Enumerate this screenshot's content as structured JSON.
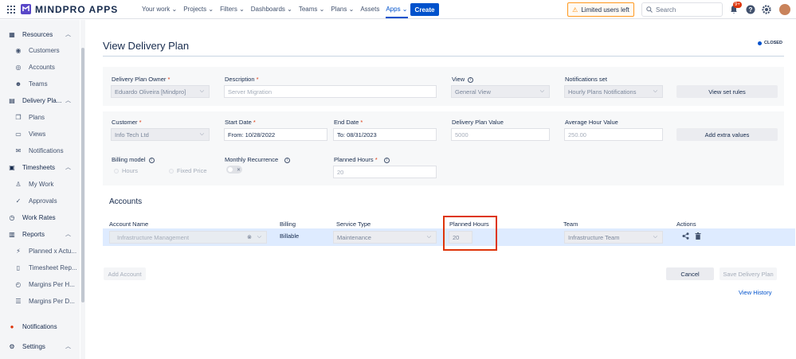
{
  "topbar": {
    "logo": "MINDPRO APPS",
    "nav": [
      "Your work",
      "Projects",
      "Filters",
      "Dashboards",
      "Teams",
      "Plans",
      "Assets",
      "Apps"
    ],
    "nav_dropdowns": [
      true,
      true,
      true,
      true,
      true,
      true,
      false,
      true
    ],
    "active_nav": "Apps",
    "create_label": "Create",
    "limited_label": "Limited users left",
    "search_placeholder": "Search",
    "notification_badge": "9+"
  },
  "sidebar": {
    "items": [
      {
        "label": "Resources",
        "type": "section",
        "icon": "grid-icon"
      },
      {
        "label": "Customers",
        "type": "item",
        "icon": "customer-icon"
      },
      {
        "label": "Accounts",
        "type": "item",
        "icon": "accounts-icon"
      },
      {
        "label": "Teams",
        "type": "item",
        "icon": "teams-icon"
      },
      {
        "label": "Delivery Pla...",
        "type": "section",
        "icon": "delivery-icon"
      },
      {
        "label": "Plans",
        "type": "item",
        "icon": "plans-icon"
      },
      {
        "label": "Views",
        "type": "item",
        "icon": "views-icon"
      },
      {
        "label": "Notifications",
        "type": "item",
        "icon": "bell-icon"
      },
      {
        "label": "Timesheets",
        "type": "section",
        "icon": "calendar-icon"
      },
      {
        "label": "My Work",
        "type": "item",
        "icon": "user-icon"
      },
      {
        "label": "Approvals",
        "type": "item",
        "icon": "check-icon"
      },
      {
        "label": "Work Rates",
        "type": "section-noexpand",
        "icon": "clock-icon"
      },
      {
        "label": "Reports",
        "type": "section",
        "icon": "bar-chart-icon"
      },
      {
        "label": "Planned x Actu...",
        "type": "item",
        "icon": "planned-icon"
      },
      {
        "label": "Timesheet Rep...",
        "type": "item",
        "icon": "document-icon"
      },
      {
        "label": "Margins Per H...",
        "type": "item",
        "icon": "margins-icon"
      },
      {
        "label": "Margins Per D...",
        "type": "item",
        "icon": "list-icon"
      },
      {
        "label": "Notifications",
        "type": "section-noexpand",
        "icon": "notification-icon"
      },
      {
        "label": "Settings",
        "type": "section",
        "icon": "gear-icon"
      }
    ]
  },
  "page": {
    "title": "View Delivery Plan",
    "status": "CLOSED"
  },
  "form": {
    "owner_label": "Delivery Plan Owner",
    "owner_value": "Eduardo Oliveira [Mindpro]",
    "description_label": "Description",
    "description_value": "Server Migration",
    "view_label": "View",
    "view_value": "General View",
    "notifications_label": "Notifications set",
    "notifications_value": "Hourly Plans Notifications",
    "view_rules_btn": "View set rules",
    "customer_label": "Customer",
    "customer_value": "Info Tech Ltd",
    "start_label": "Start Date",
    "start_value": "From: 10/28/2022",
    "end_label": "End Date",
    "end_value": "To: 08/31/2023",
    "plan_value_label": "Delivery Plan Value",
    "plan_value": "5000",
    "avg_hour_label": "Average Hour Value",
    "avg_hour_value": "250.00",
    "extra_values_btn": "Add extra values",
    "billing_label": "Billing model",
    "billing_hours": "Hours",
    "billing_fixed": "Fixed Price",
    "recurrence_label": "Monthly Recurrence",
    "planned_label": "Planned Hours",
    "planned_value": "20"
  },
  "accounts": {
    "title": "Accounts",
    "headers": {
      "name": "Account Name",
      "billing": "Billing",
      "service": "Service Type",
      "hours": "Planned Hours",
      "team": "Team",
      "actions": "Actions"
    },
    "row": {
      "name": "Infrastructure Management",
      "billing": "Billable",
      "service": "Maintenance",
      "hours": "20",
      "team": "Infrastructure Team"
    },
    "add_btn": "Add Account"
  },
  "footer": {
    "cancel": "Cancel",
    "save": "Save Delivery Plan",
    "history": "View History"
  }
}
